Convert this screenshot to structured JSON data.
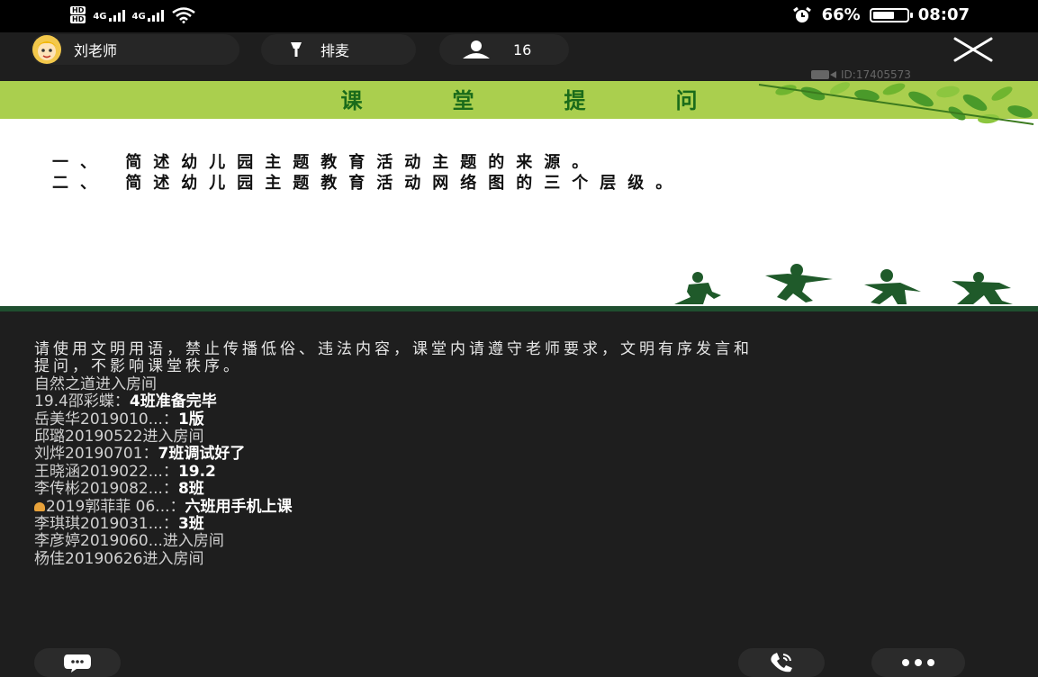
{
  "status_bar": {
    "hd_label": "HD",
    "sim_index": [
      "1",
      "2"
    ],
    "network1": "4G",
    "network2": "4G",
    "battery_percent": "66%",
    "battery_level": 0.66,
    "time": "08:07"
  },
  "top_bar": {
    "teacher_name": "刘老师",
    "mic_queue_label": "排麦",
    "viewer_count": "16"
  },
  "room_id": "ID:17405573",
  "slide": {
    "title": "课堂提问",
    "questions": [
      "一、 简述幼儿园主题教育活动主题的来源。",
      "二、 简述幼儿园主题教育活动网络图的三个层级。"
    ]
  },
  "chat": {
    "notice": "请使用文明用语，禁止传播低俗、违法内容，课堂内请遵守老师要求，文明有序发言和提问，不影响课堂秩序。",
    "messages": [
      {
        "name": "自然之道进入房间",
        "text": ""
      },
      {
        "name": "19.4邵彩蝶：",
        "text": "4班准备完毕"
      },
      {
        "name": "岳美华2019010...：",
        "text": "1版"
      },
      {
        "name": "邱璐20190522进入房间",
        "text": ""
      },
      {
        "name": "刘烨20190701：",
        "text": "7班调试好了"
      },
      {
        "name": "王晓涵2019022...：",
        "text": "19.2"
      },
      {
        "name": "李传彬2019082...：",
        "text": "8班"
      },
      {
        "name": "2019郭菲菲 06...：",
        "text": "六班用手机上课"
      },
      {
        "name": "李琪琪2019031...：",
        "text": "3班"
      },
      {
        "name": "李彦婷2019060...进入房间",
        "text": ""
      },
      {
        "name": "杨佳20190626进入房间",
        "text": ""
      }
    ]
  },
  "icons": {
    "close": "close-icon",
    "mic": "microphone-icon",
    "user": "user-icon",
    "chat": "chat-bubble-icon",
    "phone": "phone-icon",
    "more": "more-icon",
    "alarm": "alarm-icon",
    "wifi": "wifi-icon"
  },
  "colors": {
    "background": "#1e1e1e",
    "slide_header": "#aacf4e",
    "slide_title": "#1a6b1a",
    "silhouette": "#1f5a2a"
  }
}
